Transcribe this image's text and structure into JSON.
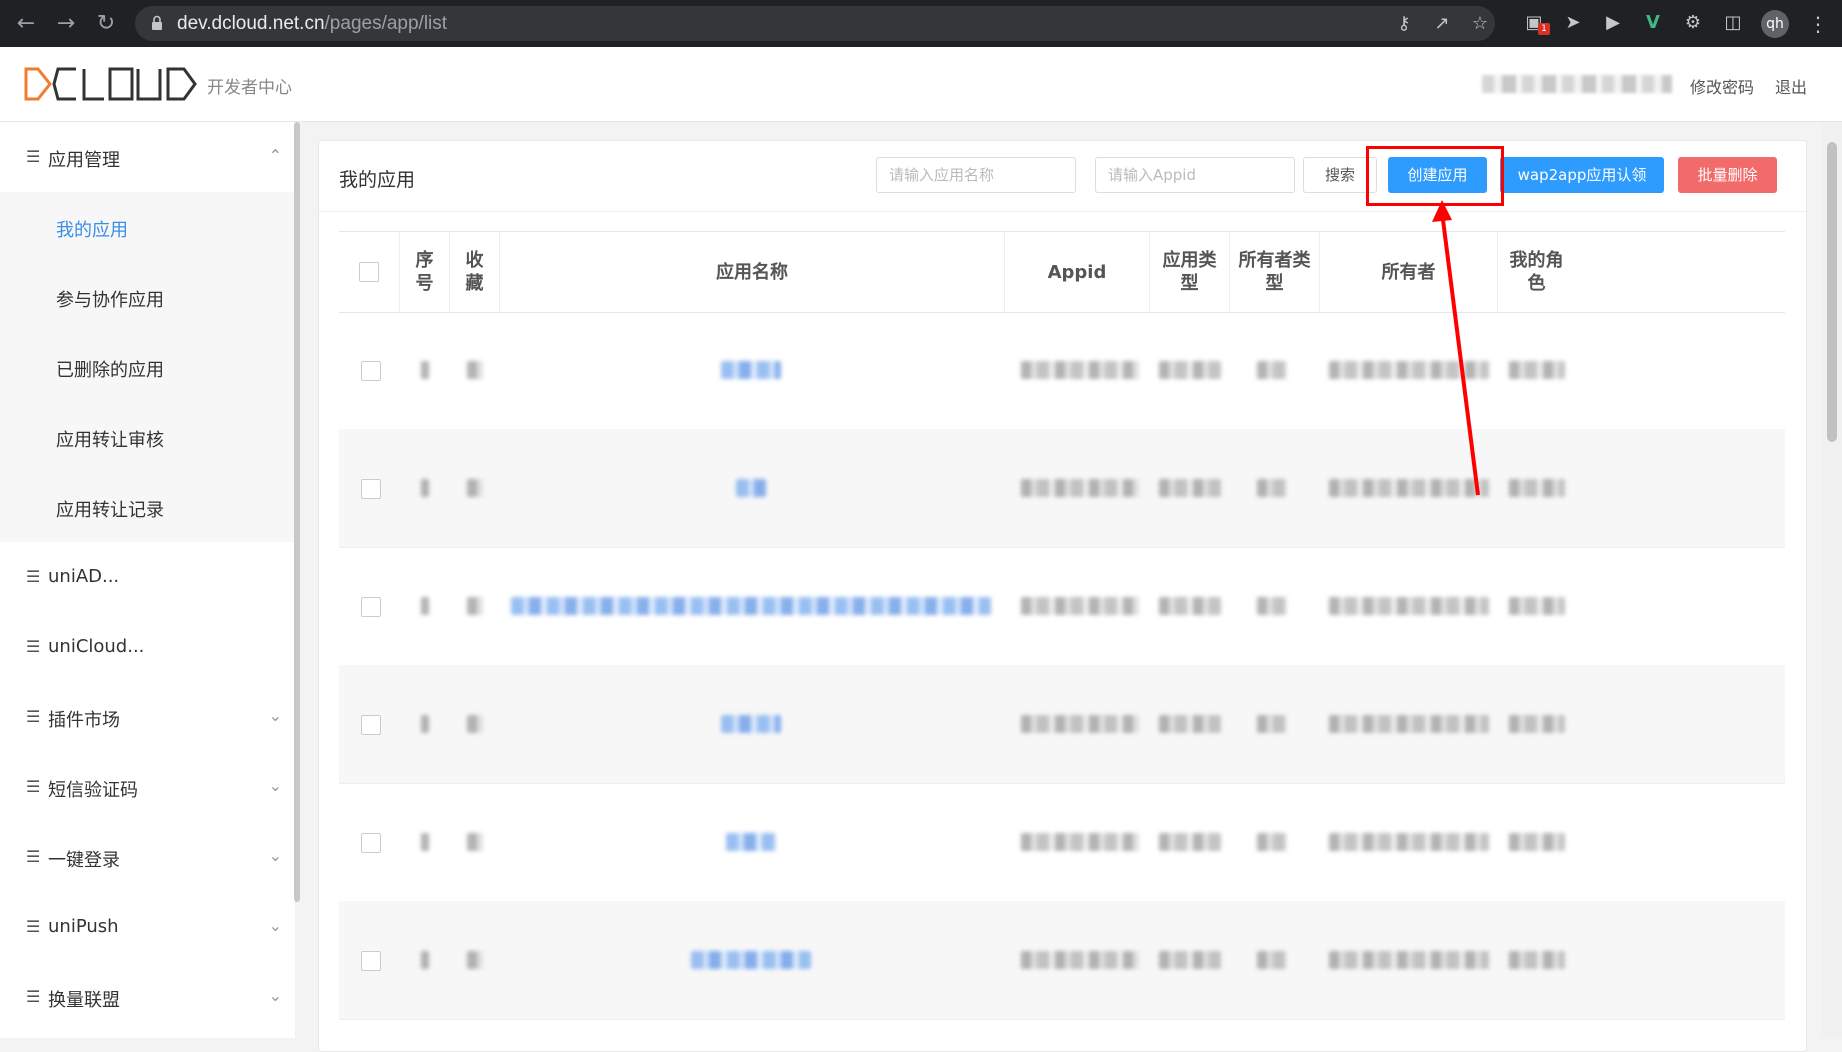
{
  "browser": {
    "url_host": "dev.dcloud.net.cn",
    "url_path": "/pages/app/list",
    "profile_initials": "qh",
    "ext_badge": "1"
  },
  "header": {
    "logo_text": "DCLOUD",
    "subtitle": "开发者中心",
    "change_password": "修改密码",
    "logout": "退出"
  },
  "sidebar": {
    "groups": [
      {
        "label": "应用管理",
        "expanded": true
      },
      {
        "label": "uniAD..."
      },
      {
        "label": "uniCloud..."
      },
      {
        "label": "插件市场"
      },
      {
        "label": "短信验证码"
      },
      {
        "label": "一键登录"
      },
      {
        "label": "uniPush"
      },
      {
        "label": "换量联盟"
      }
    ],
    "subitems": [
      {
        "label": "我的应用",
        "active": true
      },
      {
        "label": "参与协作应用"
      },
      {
        "label": "已删除的应用"
      },
      {
        "label": "应用转让审核"
      },
      {
        "label": "应用转让记录"
      }
    ]
  },
  "main": {
    "title": "我的应用",
    "app_name_placeholder": "请输入应用名称",
    "appid_placeholder": "请输入Appid",
    "search_label": "搜索",
    "create_label": "创建应用",
    "wap2app_label": "wap2app应用认领",
    "batch_delete_label": "批量删除",
    "table_headers": {
      "index": "序\n号",
      "favorite": "收\n藏",
      "app_name": "应用名称",
      "appid": "Appid",
      "app_type": "应用类\n型",
      "owner_type": "所有者类\n型",
      "owner": "所有者",
      "my_role": "我的角\n色"
    }
  },
  "colors": {
    "primary": "#2e9bff",
    "danger": "#f26b6b",
    "active_link": "#3a8ee6",
    "highlight_box": "#ff0000"
  }
}
